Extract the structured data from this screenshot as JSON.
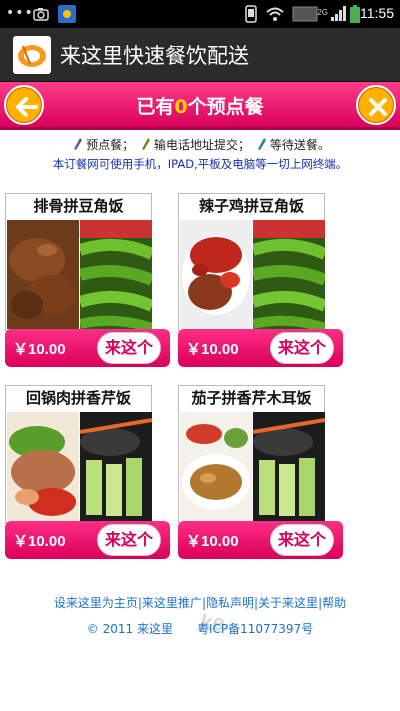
{
  "status_bar": {
    "dots": "•••",
    "network": "2G",
    "time": "11:55",
    "icons": [
      "camera-icon",
      "weather-icon",
      "phone-icon",
      "wifi-icon",
      "signal-icon",
      "battery-icon"
    ]
  },
  "app": {
    "title": "来这里快速餐饮配送",
    "logo_icon": "restaurant-logo-icon"
  },
  "header": {
    "prefix": "已有",
    "count": "0",
    "suffix": "个预点餐",
    "back_icon": "arrow-left-icon",
    "close_icon": "close-icon",
    "accent_color": "#e0006a",
    "button_color": "#ffb000"
  },
  "steps": {
    "step1": "预点餐；",
    "step2": "输电话地址提交；",
    "step3": "等待送餐。"
  },
  "notice": "本订餐网可使用手机，IPAD,平板及电脑等一切上网终端。",
  "menu": [
    {
      "name": "排骨拼豆角饭",
      "price": "￥10.00",
      "order_label": "来这个"
    },
    {
      "name": "辣子鸡拼豆角饭",
      "price": "￥10.00",
      "order_label": "来这个"
    },
    {
      "name": "回锅肉拼香芹饭",
      "price": "￥10.00",
      "order_label": "来这个"
    },
    {
      "name": "茄子拼香芹木耳饭",
      "price": "￥10.00",
      "order_label": "来这个"
    }
  ],
  "footer": {
    "links": [
      "设来这里为主页",
      "来这里推广",
      "隐私声明",
      "关于来这里",
      "帮助"
    ],
    "copyright": "© 2011 来这里",
    "icp": "粤ICP备11077397号"
  }
}
